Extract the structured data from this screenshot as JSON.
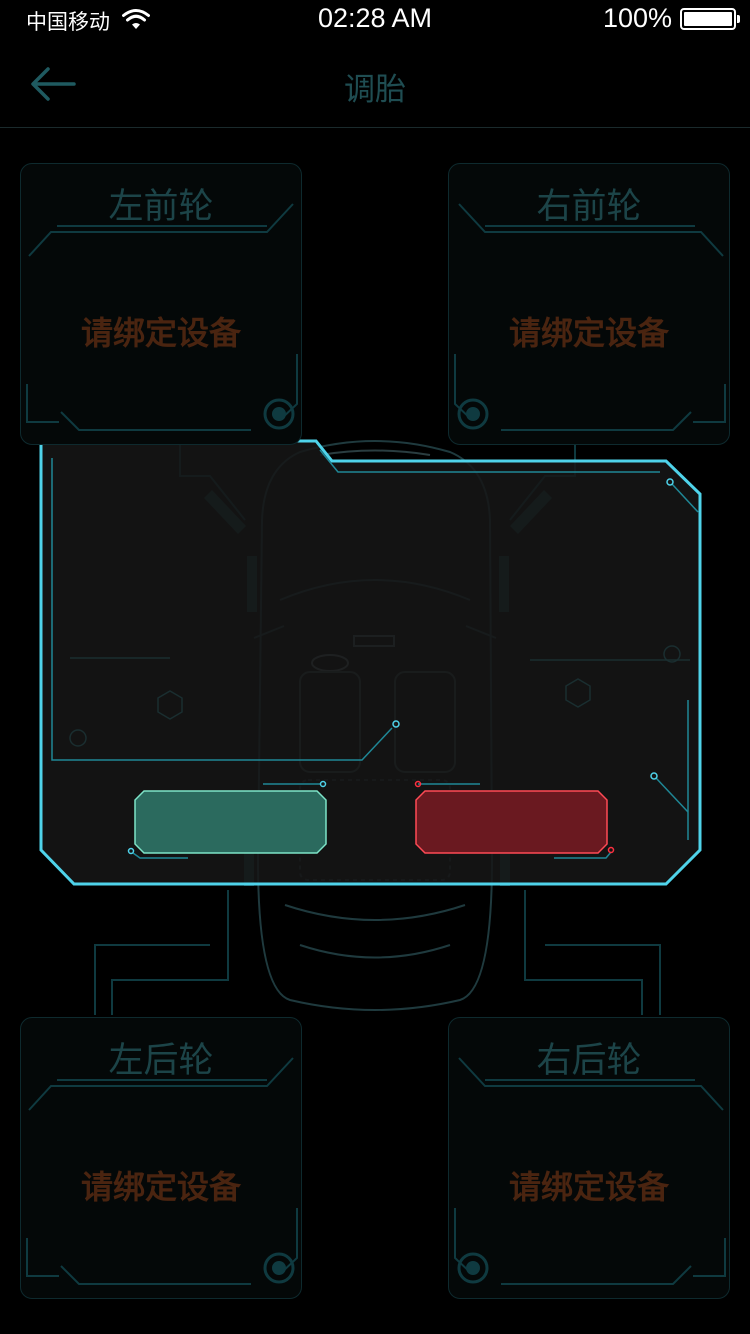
{
  "status_bar": {
    "carrier": "中国移动",
    "time": "02:28 AM",
    "battery_percent": "100%"
  },
  "nav": {
    "title": "调胎",
    "back_icon": "arrow-left-icon"
  },
  "tires": [
    {
      "name": "左前轮",
      "status": "请绑定设备"
    },
    {
      "name": "右前轮",
      "status": "请绑定设备"
    },
    {
      "name": "左后轮",
      "status": "请绑定设备"
    },
    {
      "name": "右后轮",
      "status": "请绑定设备"
    }
  ],
  "colors": {
    "accent_cyan": "#4fd3ea",
    "teal_button": "#2e6b60",
    "red_button": "#6b1a22",
    "status_text": "#4a2410",
    "title_text": "#1c4448"
  }
}
